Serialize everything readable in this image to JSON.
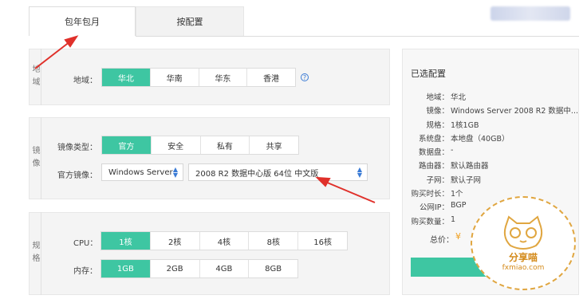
{
  "tabs": [
    {
      "label": "包年包月",
      "active": true
    },
    {
      "label": "按配置",
      "active": false
    }
  ],
  "region": {
    "section_label": "地域",
    "row_label": "地域：",
    "options": [
      "华北",
      "华南",
      "华东",
      "香港"
    ],
    "selected": "华北",
    "help_icon": "question-circle-icon"
  },
  "image": {
    "section_label": "镜像",
    "type_label": "镜像类型：",
    "types": [
      "官方",
      "安全",
      "私有",
      "共享"
    ],
    "selected_type": "官方",
    "official_label": "官方镜像：",
    "os_select": "Windows Server",
    "version_select": "2008 R2 数据中心版 64位 中文版"
  },
  "spec": {
    "section_label": "规格",
    "cpu_label": "CPU：",
    "cpu_options": [
      "1核",
      "2核",
      "4核",
      "8核",
      "16核"
    ],
    "cpu_selected": "1核",
    "mem_label": "内存：",
    "mem_options": [
      "1GB",
      "2GB",
      "4GB",
      "8GB"
    ],
    "mem_selected": "1GB"
  },
  "summary": {
    "title": "已选配置",
    "rows": [
      {
        "k": "地域：",
        "v": "华北"
      },
      {
        "k": "镜像：",
        "v": "Windows Server 2008 R2 数据中..."
      },
      {
        "k": "规格：",
        "v": "1核1GB"
      },
      {
        "k": "系统盘：",
        "v": "本地盘（40GB）"
      },
      {
        "k": "数据盘：",
        "v": "-"
      },
      {
        "k": "路由器：",
        "v": "默认路由器"
      },
      {
        "k": "子网：",
        "v": "默认子网"
      },
      {
        "k": "购买时长：",
        "v": "1个"
      },
      {
        "k": "公网IP：",
        "v": "BGP"
      },
      {
        "k": "购买数量：",
        "v": "1"
      }
    ],
    "total_label": "总价：",
    "currency": "¥"
  },
  "watermark": {
    "line1": "分享喵",
    "line2": "fxmiao.com"
  },
  "colors": {
    "accent": "#3ec6a2",
    "link": "#3a7bd5",
    "annotation_arrow": "#e0302a"
  }
}
